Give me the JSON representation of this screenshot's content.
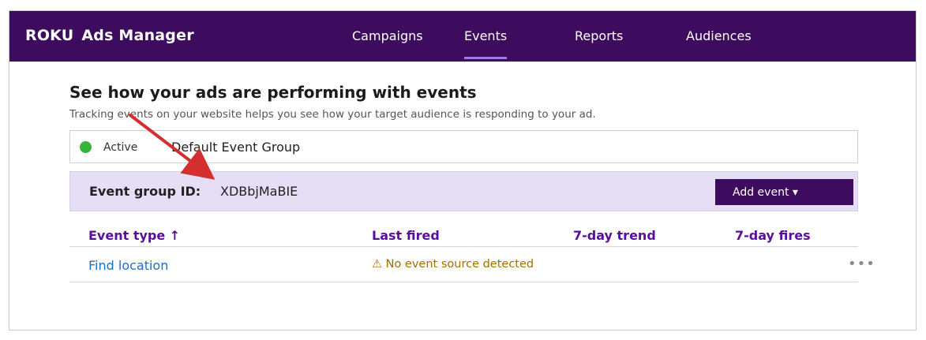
{
  "brand": {
    "logo": "ROKU",
    "app_name": "Ads Manager"
  },
  "nav": {
    "items": [
      {
        "label": "Campaigns",
        "active": false
      },
      {
        "label": "Events",
        "active": true
      },
      {
        "label": "Reports",
        "active": false
      },
      {
        "label": "Audiences",
        "active": false
      }
    ]
  },
  "page": {
    "headline": "See how your ads are performing with events",
    "subtext": "Tracking events on your website helps you see how your target audience is responding to your ad."
  },
  "event_group": {
    "status": "Active",
    "name": "Default Event Group",
    "id_label": "Event group ID:",
    "id_value": "XDBbjMaBIE",
    "add_event_label": "Add event ▾"
  },
  "table": {
    "columns": [
      "Event type ↑",
      "Last fired",
      "7-day trend",
      "7-day fires"
    ],
    "rows": [
      {
        "event_type": "Find location",
        "last_fired": "⚠ No event source detected",
        "more": "•••"
      }
    ]
  },
  "colors": {
    "brand_purple": "#3e0c5e",
    "status_green": "#35b43c",
    "header_text": "#5a0f9c",
    "link_blue": "#1f6fc4",
    "warning": "#a36e00",
    "annotation_arrow": "#d32f2f"
  },
  "icons": {
    "status": "green-dot-icon",
    "sort": "sort-up-arrow",
    "more": "more-options-icon",
    "warning": "warning-icon",
    "dropdown": "caret-down-icon"
  }
}
